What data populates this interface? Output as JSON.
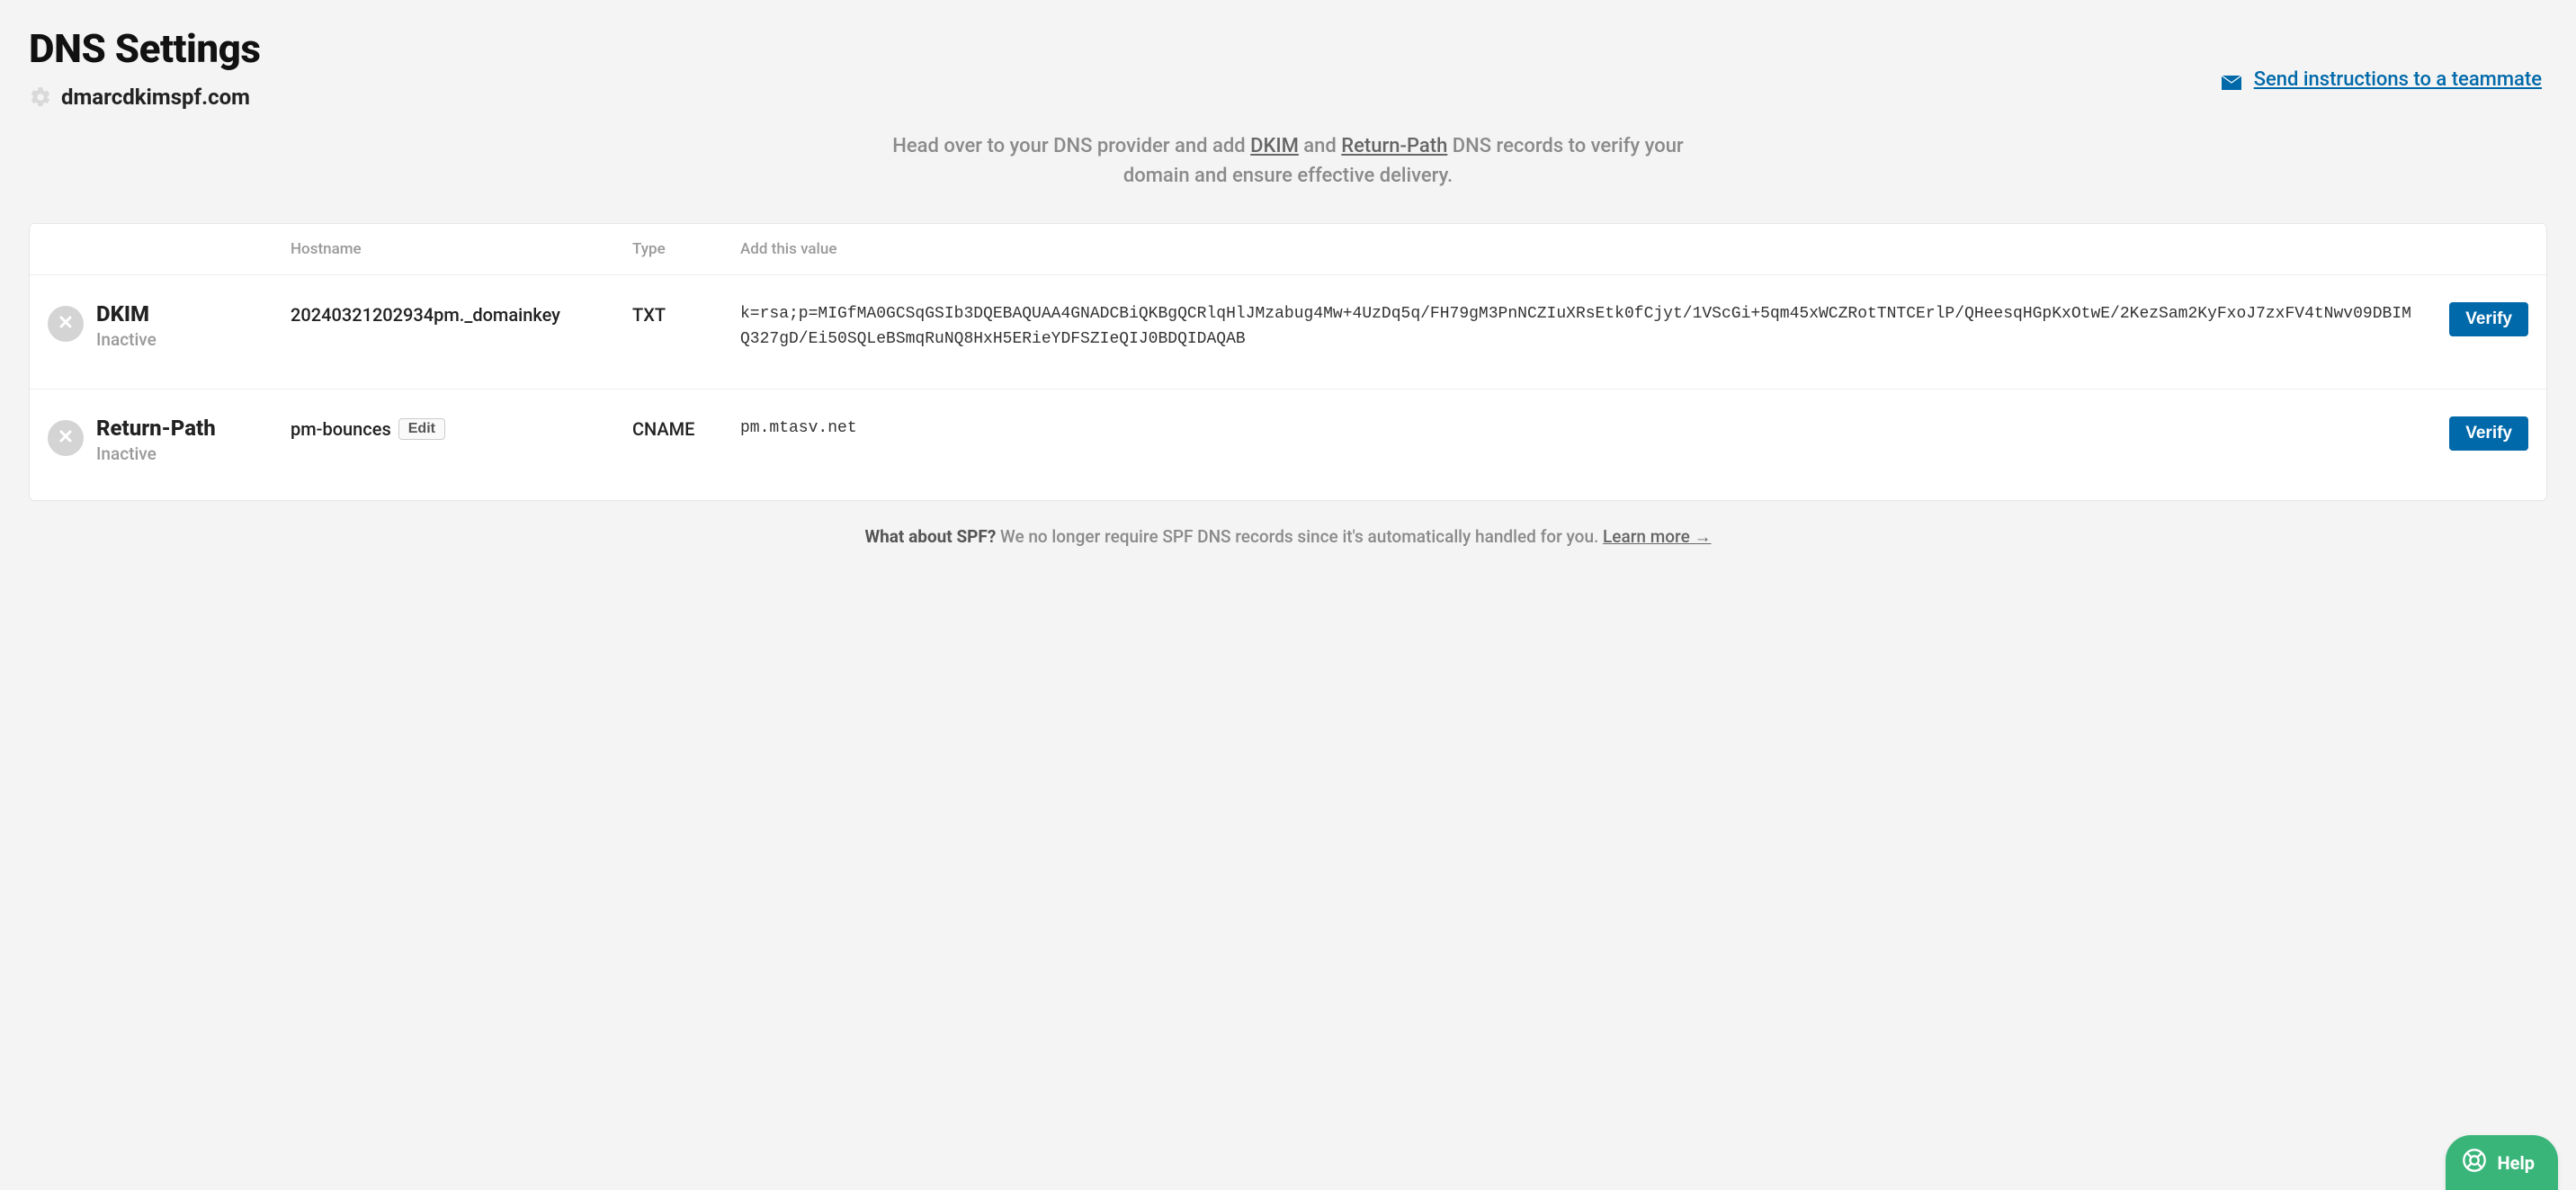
{
  "header": {
    "title": "DNS Settings",
    "domain": "dmarcdkimspf.com",
    "send_link": "Send instructions to a teammate"
  },
  "intro": {
    "prefix": "Head over to your DNS provider and add ",
    "dkim_link": "DKIM",
    "mid": " and ",
    "returnpath_link": "Return-Path",
    "suffix": " DNS records to verify your domain and ensure effective delivery."
  },
  "table": {
    "headers": {
      "hostname": "Hostname",
      "type": "Type",
      "value": "Add this value"
    },
    "rows": {
      "dkim": {
        "name": "DKIM",
        "status": "Inactive",
        "hostname": "20240321202934pm._domainkey",
        "type": "TXT",
        "value": "k=rsa;p=MIGfMA0GCSqGSIb3DQEBAQUAA4GNADCBiQKBgQCRlqHlJMzabug4Mw+4UzDq5q/FH79gM3PnNCZIuXRsEtk0fCjyt/1VScGi+5qm45xWCZRotTNTCErlP/QHeesqHGpKxOtwE/2KezSam2KyFxoJ7zxFV4tNwv09DBIMQ327gD/Ei50SQLeBSmqRuNQ8HxH5ERieYDFSZIeQIJ0BDQIDAQAB",
        "verify": "Verify"
      },
      "returnpath": {
        "name": "Return-Path",
        "status": "Inactive",
        "hostname": "pm-bounces",
        "edit": "Edit",
        "type": "CNAME",
        "value": "pm.mtasv.net",
        "verify": "Verify"
      }
    }
  },
  "spf": {
    "lead": "What about SPF?",
    "body": " We no longer require SPF DNS records since it's automatically handled for you. ",
    "learn": "Learn more →"
  },
  "help": {
    "label": "Help"
  }
}
